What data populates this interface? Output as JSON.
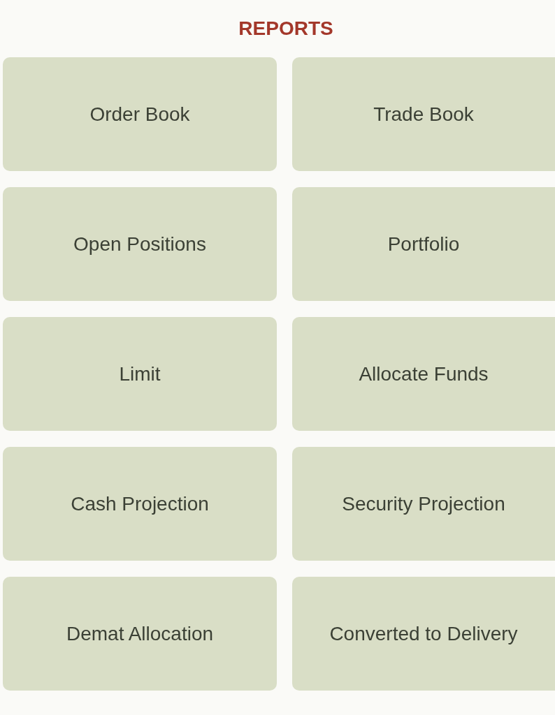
{
  "title": "REPORTS",
  "tiles": [
    {
      "label": "Order Book"
    },
    {
      "label": "Trade Book"
    },
    {
      "label": "Open Positions"
    },
    {
      "label": "Portfolio"
    },
    {
      "label": "Limit"
    },
    {
      "label": "Allocate Funds"
    },
    {
      "label": "Cash Projection"
    },
    {
      "label": "Security Projection"
    },
    {
      "label": "Demat Allocation"
    },
    {
      "label": "Converted to Delivery"
    }
  ]
}
